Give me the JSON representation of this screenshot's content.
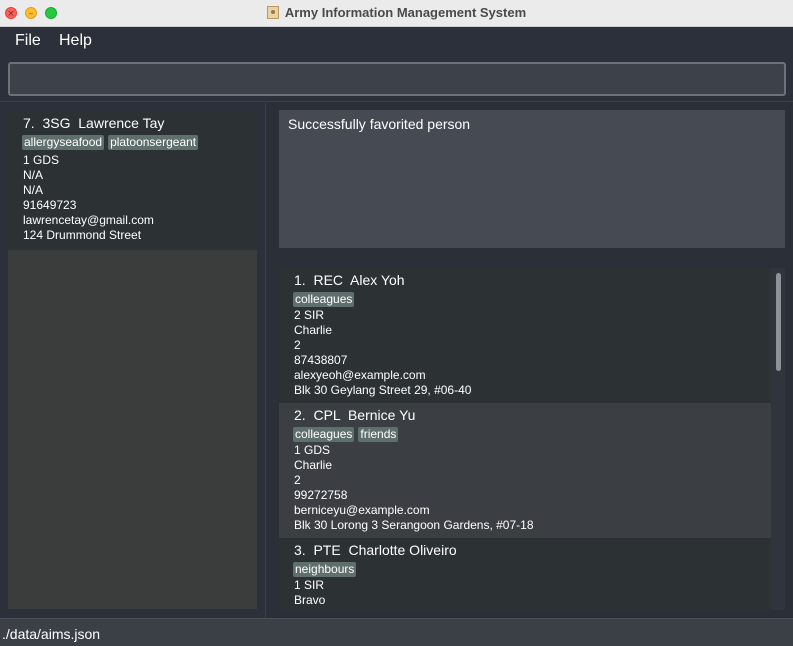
{
  "window": {
    "title": "Army Information Management System"
  },
  "menu": {
    "file": "File",
    "help": "Help"
  },
  "command": {
    "value": ""
  },
  "result": {
    "message": "Successfully favorited person"
  },
  "pinned": [
    {
      "index": "7.",
      "rank": "3SG",
      "name": "Lawrence Tay",
      "tags": [
        "allergyseafood",
        "platoonsergeant"
      ],
      "unit": "1 GDS",
      "company": "N/A",
      "platoon": "N/A",
      "phone": "91649723",
      "email": "lawrencetay@gmail.com",
      "address": "124 Drummond Street"
    }
  ],
  "persons": [
    {
      "index": "1.",
      "rank": "REC",
      "name": "Alex Yoh",
      "tags": [
        "colleagues"
      ],
      "unit": "2 SIR",
      "company": "Charlie",
      "platoon": "2",
      "phone": "87438807",
      "email": "alexyeoh@example.com",
      "address": "Blk 30 Geylang Street 29, #06-40"
    },
    {
      "index": "2.",
      "rank": "CPL",
      "name": "Bernice Yu",
      "tags": [
        "colleagues",
        "friends"
      ],
      "unit": "1 GDS",
      "company": "Charlie",
      "platoon": "2",
      "phone": "99272758",
      "email": "berniceyu@example.com",
      "address": "Blk 30 Lorong 3 Serangoon Gardens, #07-18"
    },
    {
      "index": "3.",
      "rank": "PTE",
      "name": "Charlotte Oliveiro",
      "tags": [
        "neighbours"
      ],
      "unit": "1 SIR",
      "company": "Bravo"
    }
  ],
  "status": {
    "path": "./data/aims.json"
  },
  "colors": {
    "background": "#2b303a",
    "card_dark": "#2c3134",
    "card_light": "#3b3f43",
    "tag": "#5e6f6c",
    "result_box": "#464a52"
  },
  "icons": {
    "close": "close-icon",
    "minimize": "minimize-icon",
    "maximize": "maximize-icon",
    "app": "app-icon"
  }
}
